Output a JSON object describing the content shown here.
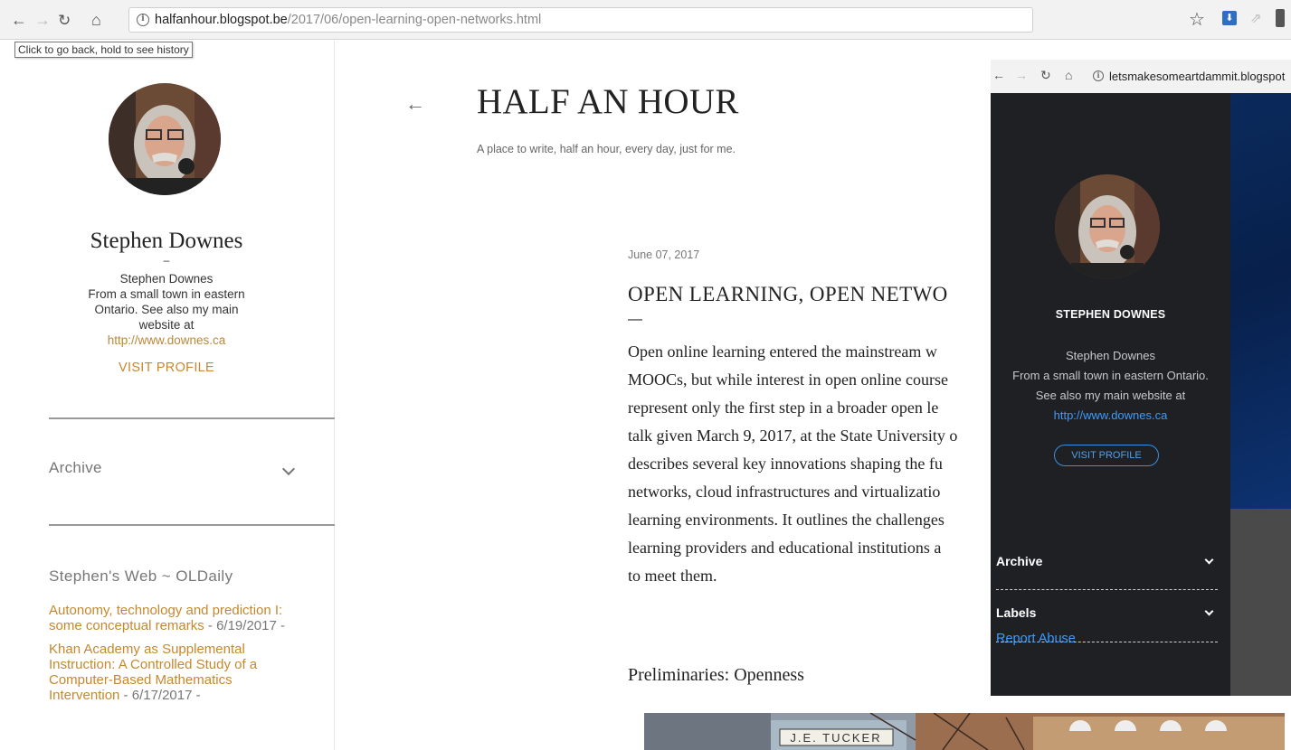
{
  "browser": {
    "url_host": "halfanhour.blogspot.be",
    "url_path": "/2017/06/open-learning-open-networks.html",
    "back_tooltip": "Click to go back, hold to see history",
    "icons": [
      "back-arrow-icon",
      "forward-arrow-icon",
      "reload-icon",
      "home-icon",
      "info-icon",
      "bookmark-star-icon",
      "download-extension-icon",
      "share-extension-icon",
      "extension-icon"
    ]
  },
  "sidebar": {
    "name": "Stephen Downes",
    "dash": "–",
    "about_line1": "Stephen Downes",
    "about_line2": "From a small town in eastern",
    "about_line3": "Ontario. See also my main",
    "about_line4": "website at",
    "about_link": "http://www.downes.ca",
    "visit_profile": "VISIT PROFILE",
    "archive_label": "Archive",
    "widget_title": "Stephen's Web ~ OLDaily",
    "feed": [
      {
        "link": "Autonomy, technology and prediction I: some conceptual remarks",
        "meta": " - 6/19/2017 -"
      },
      {
        "link": "Khan Academy as Supplemental Instruction: A Controlled Study of a Computer-Based Mathematics Intervention",
        "meta": " - 6/17/2017 -"
      }
    ]
  },
  "blog": {
    "title": "HALF AN HOUR",
    "description": "A place to write, half an hour, every day, just for me."
  },
  "post": {
    "date": "June 07, 2017",
    "title": "OPEN LEARNING, OPEN NETWO",
    "dash": "—",
    "body_lines": [
      "Open online learning entered the mainstream w",
      "MOOCs, but while interest in open online course",
      "represent only the first step in a broader open le",
      "talk given March 9, 2017, at the State University o",
      "describes several key innovations shaping the fu",
      "networks, cloud infrastructures and virtualizatio",
      "learning environments. It outlines the challenges",
      "learning providers and educational institutions a",
      "to meet them."
    ],
    "subheading": "Preliminaries: Openness",
    "image_sign": "J.E. TUCKER"
  },
  "overlay": {
    "url": "letsmakesomeartdammit.blogspot",
    "name": "STEPHEN DOWNES",
    "about_line1": "Stephen Downes",
    "about_line2": "From a small town in eastern Ontario.",
    "about_line3": "See also my main website at",
    "about_link": "http://www.downes.ca",
    "visit_profile": "VISIT PROFILE",
    "archive_label": "Archive",
    "labels_label": "Labels",
    "report_abuse": "Report Abuse"
  },
  "colors": {
    "accent_link": "#c5882e",
    "overlay_bg": "#1f2024",
    "overlay_link": "#3b9bff"
  }
}
